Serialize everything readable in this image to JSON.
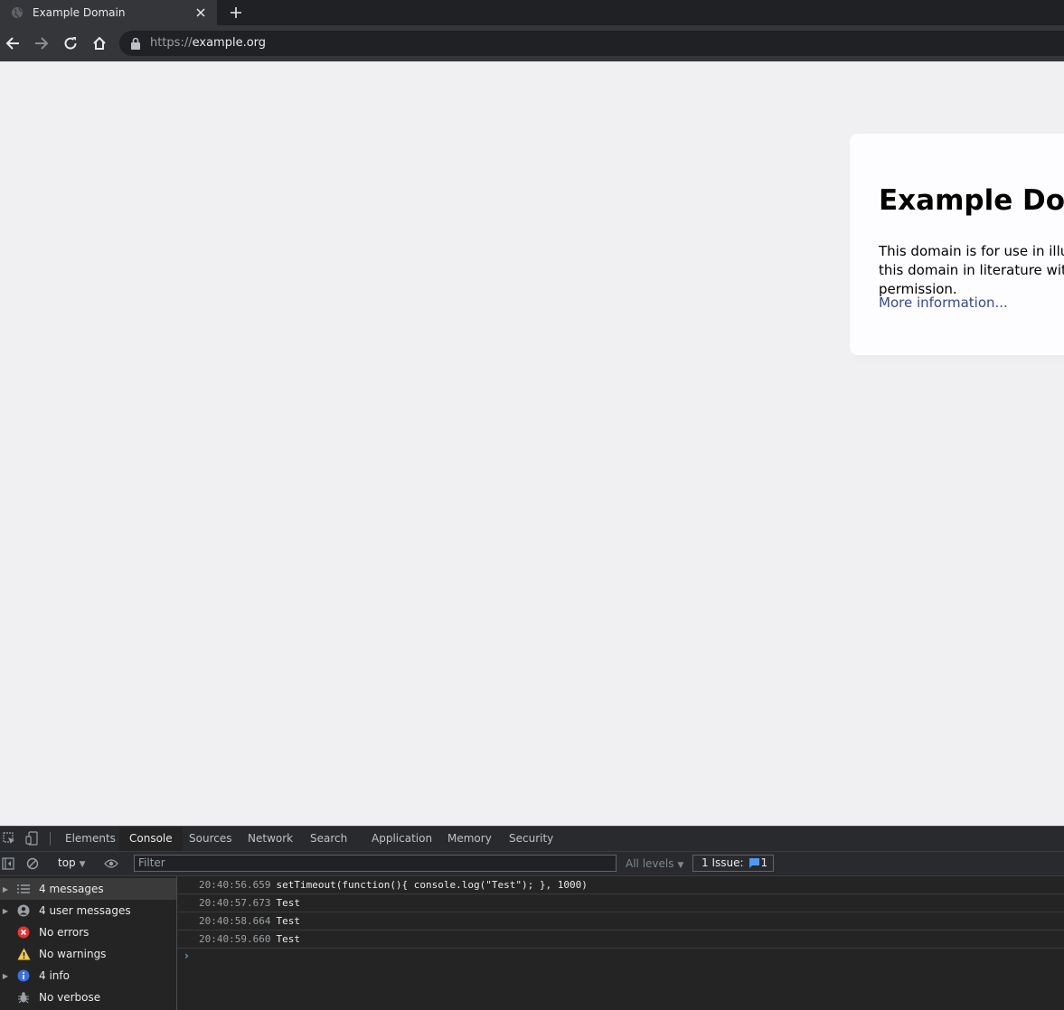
{
  "browser": {
    "tab_title": "Example Domain",
    "url_scheme": "https://",
    "url_host": "example.org"
  },
  "page": {
    "heading": "Example Domain",
    "description": "This domain is for use in illustrative examples in documents. You may use this domain in literature without prior coordination or asking for permission.",
    "link_text": "More information..."
  },
  "devtools": {
    "tabs": [
      "Elements",
      "Console",
      "Sources",
      "Network",
      "Search",
      "Application",
      "Memory",
      "Security"
    ],
    "active_tab": "Console",
    "context": "top",
    "filter_placeholder": "Filter",
    "levels": "All levels",
    "issues_label": "1 Issue:",
    "issues_count": "1",
    "sidebar": [
      {
        "label": "4 messages",
        "icon": "list-icon"
      },
      {
        "label": "4 user messages",
        "icon": "user-icon"
      },
      {
        "label": "No errors",
        "icon": "error-icon"
      },
      {
        "label": "No warnings",
        "icon": "warning-icon"
      },
      {
        "label": "4 info",
        "icon": "info-icon"
      },
      {
        "label": "No verbose",
        "icon": "bug-icon"
      }
    ],
    "logs": [
      {
        "time": "20:40:56.659",
        "text": "setTimeout(function(){ console.log(\"Test\"); }, 1000)"
      },
      {
        "time": "20:40:57.673",
        "text": "Test"
      },
      {
        "time": "20:40:58.664",
        "text": "Test"
      },
      {
        "time": "20:40:59.660",
        "text": "Test"
      }
    ],
    "prompt": "›"
  },
  "colors": {
    "link": "#38488f",
    "prompt": "#4d9af5",
    "error": "#e3342f",
    "warning": "#f2c94c",
    "info": "#3b6fe0"
  }
}
